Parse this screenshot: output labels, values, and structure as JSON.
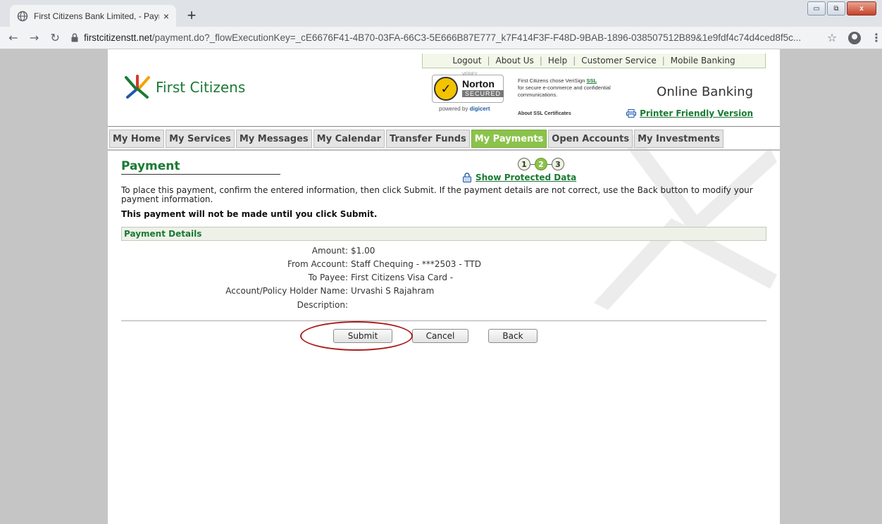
{
  "browser": {
    "tab_title": "First Citizens Bank Limited, - Payr",
    "tab_close": "×",
    "new_tab": "+",
    "url_domain": "firstcitizenstt.net",
    "url_path": "/payment.do?_flowExecutionKey=_cE6676F41-4B70-03FA-66C3-5E666B87E777_k7F414F3F-F48D-9BAB-1896-038507512B89&1e9fdf4c74d4ced8f5c...",
    "win_minimize": "▭",
    "win_restore": "⧉",
    "win_close": "x"
  },
  "top_links": [
    "Logout",
    "About Us",
    "Help",
    "Customer Service",
    "Mobile Banking"
  ],
  "header": {
    "logo_text": "First Citizens",
    "norton_verify": "VERIFY",
    "norton_name": "Norton",
    "norton_secured": "SECURED",
    "norton_powered_prefix": "powered by ",
    "norton_powered_brand": "digicert",
    "ssl_text_1": "First Citizens chose VeriSign ",
    "ssl_link": "SSL",
    "ssl_text_2": "for secure e-commerce and confidential communications.",
    "about_ssl": "About SSL Certificates",
    "online_banking": "Online Banking",
    "printer_friendly": "Printer Friendly Version"
  },
  "nav": {
    "tabs": [
      "My Home",
      "My Services",
      "My Messages",
      "My Calendar",
      "Transfer Funds",
      "My Payments",
      "Open Accounts",
      "My Investments"
    ],
    "active": "My Payments"
  },
  "payment": {
    "title": "Payment",
    "steps": [
      "1",
      "2",
      "3"
    ],
    "current_step": "2",
    "show_protected": "Show Protected Data",
    "instructions": "To place this payment, confirm the entered information, then click Submit. If the payment details are not correct, use the Back button to modify your payment information.",
    "notice": "This payment will not be made until you click Submit.",
    "details_header": "Payment Details",
    "details": [
      {
        "label": "Amount:",
        "value": "$1.00"
      },
      {
        "label": "From Account:",
        "value": "Staff Chequing - ***2503 - TTD"
      },
      {
        "label": "To Payee:",
        "value": "First Citizens Visa Card -"
      },
      {
        "label": "Account/Policy Holder Name:",
        "value": "Urvashi S Rajahram"
      },
      {
        "label": "Description:",
        "value": ""
      }
    ],
    "buttons": {
      "submit": "Submit",
      "cancel": "Cancel",
      "back": "Back"
    }
  },
  "colors": {
    "brand_green": "#1a7a34",
    "active_tab": "#8bc34a",
    "annotation_red": "#a91e1e"
  }
}
